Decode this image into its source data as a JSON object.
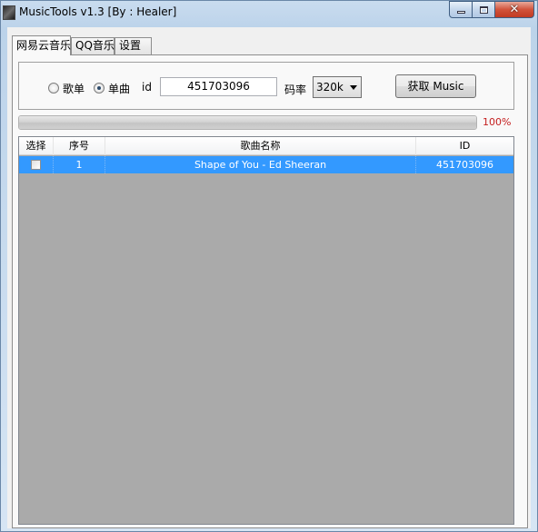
{
  "window": {
    "title": "MusicTools v1.3 [By : Healer]",
    "close_symbol": "✕"
  },
  "tabs": [
    {
      "label": "网易云音乐",
      "active": true
    },
    {
      "label": "QQ音乐",
      "active": false
    },
    {
      "label": "设置",
      "active": false
    }
  ],
  "form": {
    "mode_options": [
      {
        "label": "歌单",
        "checked": false
      },
      {
        "label": "单曲",
        "checked": true
      }
    ],
    "id_label": "id",
    "id_value": "451703096",
    "bitrate_label": "码率",
    "bitrate_selected": "320k",
    "fetch_button": "获取 Music"
  },
  "progress": {
    "value": 1.0,
    "text": "100%"
  },
  "table": {
    "columns": [
      "选择",
      "序号",
      "歌曲名称",
      "ID"
    ],
    "rows": [
      {
        "checked": false,
        "index": "1",
        "name": "Shape of You - Ed Sheeran",
        "id": "451703096"
      }
    ]
  },
  "colors": {
    "selection": "#3399ff",
    "progress_text": "#c41e1e",
    "list_background": "#aaaaaa"
  }
}
